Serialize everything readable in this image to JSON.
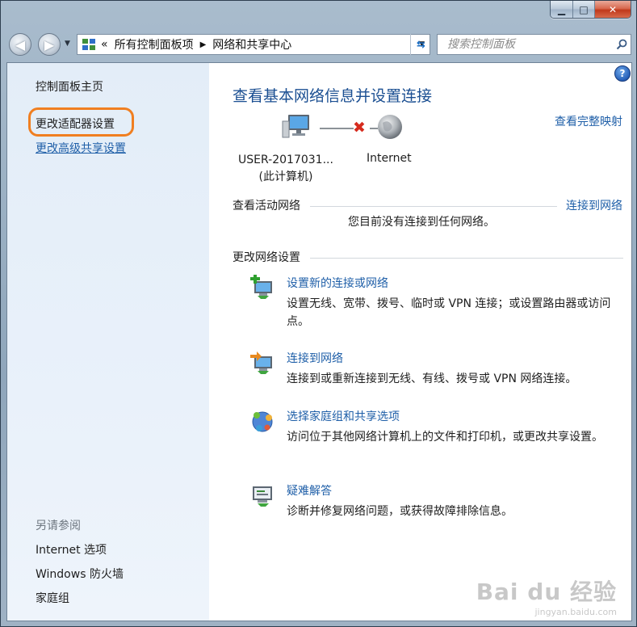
{
  "window": {
    "minimize_glyph": "▁",
    "maximize_glyph": "□",
    "close_glyph": "✕"
  },
  "navigation": {
    "back_glyph": "◀",
    "forward_glyph": "▶",
    "history_dropdown_glyph": "▼",
    "address_prefix": "«",
    "breadcrumb": [
      "所有控制面板项",
      "网络和共享中心"
    ],
    "breadcrumb_separator": "▶",
    "address_dropdown_glyph": "▼",
    "refresh_glyph": "⇆",
    "search_placeholder": "搜索控制面板"
  },
  "sidebar": {
    "home_label": "控制面板主页",
    "links": [
      "更改适配器设置",
      "更改高级共享设置"
    ],
    "see_also_label": "另请参阅",
    "see_also_items": [
      "Internet 选项",
      "Windows 防火墙",
      "家庭组"
    ]
  },
  "main": {
    "help_glyph": "?",
    "title": "查看基本网络信息并设置连接",
    "full_map_link": "查看完整映射",
    "computer_name": "USER-2017031...",
    "computer_sublabel": "(此计算机)",
    "disconnected_glyph": "✖",
    "internet_label": "Internet",
    "active_networks_label": "查看活动网络",
    "connect_link": "连接到网络",
    "no_network_text": "您目前没有连接到任何网络。",
    "change_settings_label": "更改网络设置",
    "tasks": [
      {
        "icon": "new-connection-icon",
        "link": "设置新的连接或网络",
        "description": "设置无线、宽带、拨号、临时或 VPN 连接；或设置路由器或访问点。"
      },
      {
        "icon": "connect-network-icon",
        "link": "连接到网络",
        "description": "连接到或重新连接到无线、有线、拨号或 VPN 网络连接。"
      },
      {
        "icon": "homegroup-icon",
        "link": "选择家庭组和共享选项",
        "description": "访问位于其他网络计算机上的文件和打印机，或更改共享设置。"
      },
      {
        "icon": "troubleshoot-icon",
        "link": "疑难解答",
        "description": "诊断并修复网络问题，或获得故障排除信息。"
      }
    ]
  },
  "watermark": {
    "brand": "Bai du 经验",
    "url": "jingyan.baidu.com"
  },
  "colors": {
    "link": "#1f5fa8",
    "title": "#1b4f92",
    "highlight_ring": "#f07f21",
    "error_x": "#d62b1e"
  }
}
